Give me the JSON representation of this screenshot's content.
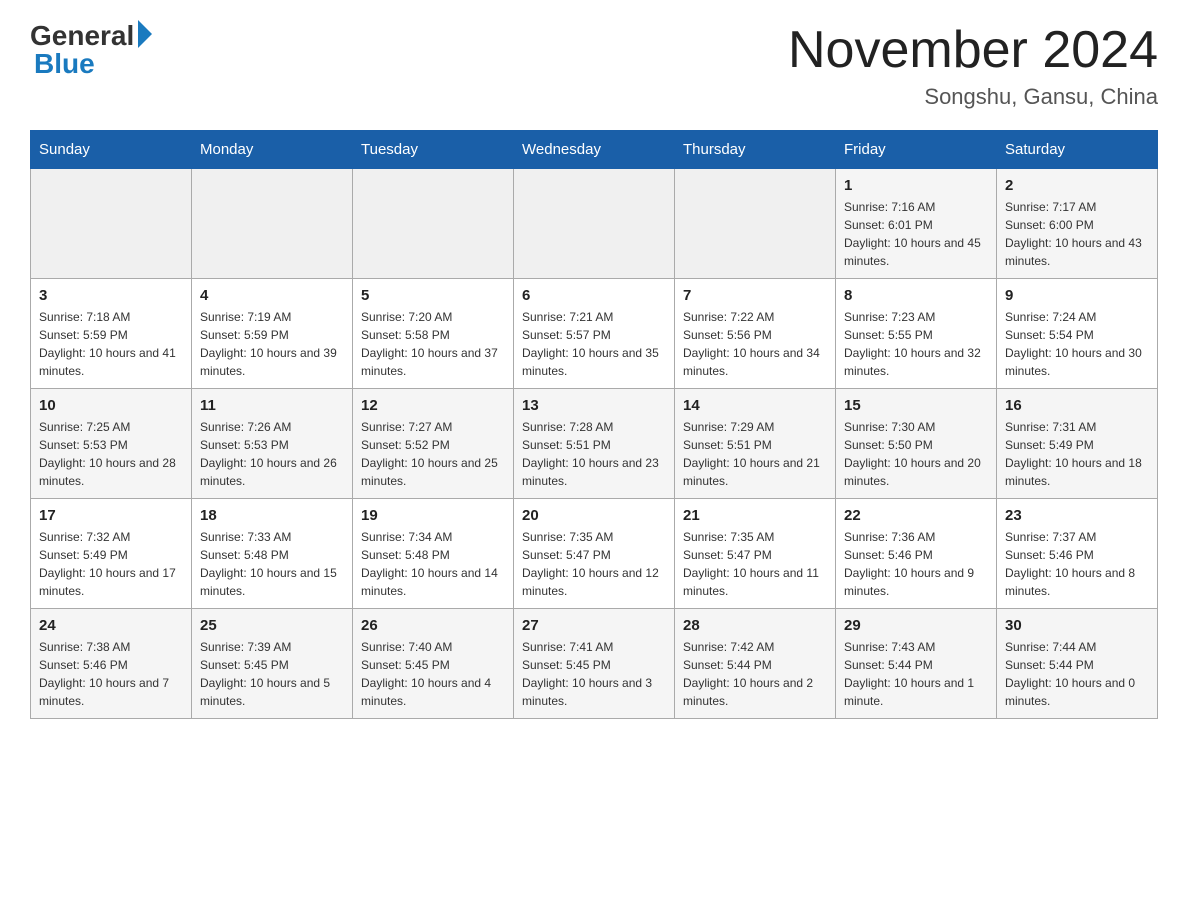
{
  "header": {
    "logo_general": "General",
    "logo_blue": "Blue",
    "month_year": "November 2024",
    "location": "Songshu, Gansu, China"
  },
  "weekdays": [
    "Sunday",
    "Monday",
    "Tuesday",
    "Wednesday",
    "Thursday",
    "Friday",
    "Saturday"
  ],
  "weeks": [
    [
      {
        "day": "",
        "info": ""
      },
      {
        "day": "",
        "info": ""
      },
      {
        "day": "",
        "info": ""
      },
      {
        "day": "",
        "info": ""
      },
      {
        "day": "",
        "info": ""
      },
      {
        "day": "1",
        "info": "Sunrise: 7:16 AM\nSunset: 6:01 PM\nDaylight: 10 hours and 45 minutes."
      },
      {
        "day": "2",
        "info": "Sunrise: 7:17 AM\nSunset: 6:00 PM\nDaylight: 10 hours and 43 minutes."
      }
    ],
    [
      {
        "day": "3",
        "info": "Sunrise: 7:18 AM\nSunset: 5:59 PM\nDaylight: 10 hours and 41 minutes."
      },
      {
        "day": "4",
        "info": "Sunrise: 7:19 AM\nSunset: 5:59 PM\nDaylight: 10 hours and 39 minutes."
      },
      {
        "day": "5",
        "info": "Sunrise: 7:20 AM\nSunset: 5:58 PM\nDaylight: 10 hours and 37 minutes."
      },
      {
        "day": "6",
        "info": "Sunrise: 7:21 AM\nSunset: 5:57 PM\nDaylight: 10 hours and 35 minutes."
      },
      {
        "day": "7",
        "info": "Sunrise: 7:22 AM\nSunset: 5:56 PM\nDaylight: 10 hours and 34 minutes."
      },
      {
        "day": "8",
        "info": "Sunrise: 7:23 AM\nSunset: 5:55 PM\nDaylight: 10 hours and 32 minutes."
      },
      {
        "day": "9",
        "info": "Sunrise: 7:24 AM\nSunset: 5:54 PM\nDaylight: 10 hours and 30 minutes."
      }
    ],
    [
      {
        "day": "10",
        "info": "Sunrise: 7:25 AM\nSunset: 5:53 PM\nDaylight: 10 hours and 28 minutes."
      },
      {
        "day": "11",
        "info": "Sunrise: 7:26 AM\nSunset: 5:53 PM\nDaylight: 10 hours and 26 minutes."
      },
      {
        "day": "12",
        "info": "Sunrise: 7:27 AM\nSunset: 5:52 PM\nDaylight: 10 hours and 25 minutes."
      },
      {
        "day": "13",
        "info": "Sunrise: 7:28 AM\nSunset: 5:51 PM\nDaylight: 10 hours and 23 minutes."
      },
      {
        "day": "14",
        "info": "Sunrise: 7:29 AM\nSunset: 5:51 PM\nDaylight: 10 hours and 21 minutes."
      },
      {
        "day": "15",
        "info": "Sunrise: 7:30 AM\nSunset: 5:50 PM\nDaylight: 10 hours and 20 minutes."
      },
      {
        "day": "16",
        "info": "Sunrise: 7:31 AM\nSunset: 5:49 PM\nDaylight: 10 hours and 18 minutes."
      }
    ],
    [
      {
        "day": "17",
        "info": "Sunrise: 7:32 AM\nSunset: 5:49 PM\nDaylight: 10 hours and 17 minutes."
      },
      {
        "day": "18",
        "info": "Sunrise: 7:33 AM\nSunset: 5:48 PM\nDaylight: 10 hours and 15 minutes."
      },
      {
        "day": "19",
        "info": "Sunrise: 7:34 AM\nSunset: 5:48 PM\nDaylight: 10 hours and 14 minutes."
      },
      {
        "day": "20",
        "info": "Sunrise: 7:35 AM\nSunset: 5:47 PM\nDaylight: 10 hours and 12 minutes."
      },
      {
        "day": "21",
        "info": "Sunrise: 7:35 AM\nSunset: 5:47 PM\nDaylight: 10 hours and 11 minutes."
      },
      {
        "day": "22",
        "info": "Sunrise: 7:36 AM\nSunset: 5:46 PM\nDaylight: 10 hours and 9 minutes."
      },
      {
        "day": "23",
        "info": "Sunrise: 7:37 AM\nSunset: 5:46 PM\nDaylight: 10 hours and 8 minutes."
      }
    ],
    [
      {
        "day": "24",
        "info": "Sunrise: 7:38 AM\nSunset: 5:46 PM\nDaylight: 10 hours and 7 minutes."
      },
      {
        "day": "25",
        "info": "Sunrise: 7:39 AM\nSunset: 5:45 PM\nDaylight: 10 hours and 5 minutes."
      },
      {
        "day": "26",
        "info": "Sunrise: 7:40 AM\nSunset: 5:45 PM\nDaylight: 10 hours and 4 minutes."
      },
      {
        "day": "27",
        "info": "Sunrise: 7:41 AM\nSunset: 5:45 PM\nDaylight: 10 hours and 3 minutes."
      },
      {
        "day": "28",
        "info": "Sunrise: 7:42 AM\nSunset: 5:44 PM\nDaylight: 10 hours and 2 minutes."
      },
      {
        "day": "29",
        "info": "Sunrise: 7:43 AM\nSunset: 5:44 PM\nDaylight: 10 hours and 1 minute."
      },
      {
        "day": "30",
        "info": "Sunrise: 7:44 AM\nSunset: 5:44 PM\nDaylight: 10 hours and 0 minutes."
      }
    ]
  ]
}
